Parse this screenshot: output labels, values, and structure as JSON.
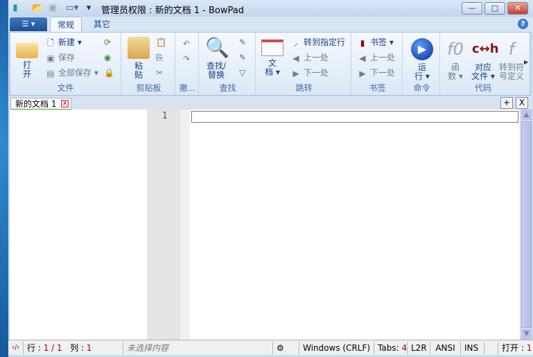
{
  "window": {
    "title": "管理员权限 : 新的文档 1 - BowPad",
    "minimize": "—",
    "maximize": "□",
    "close": "✕"
  },
  "ribbon": {
    "tabs": [
      {
        "label": "常规"
      },
      {
        "label": "其它"
      }
    ],
    "help": "?",
    "groups": {
      "file": {
        "label": "文件",
        "open": "打\n开",
        "new": "新建",
        "save": "保存",
        "save_all": "全部保存"
      },
      "clipboard": {
        "label": "剪贴板",
        "paste": "粘\n贴"
      },
      "undo": {
        "label": "撤..."
      },
      "find": {
        "label": "查找",
        "find_replace": "查找/\n替换"
      },
      "jump": {
        "label": "跳转",
        "doc": "文\n档",
        "goto_line": "转到指定行",
        "prev": "上一处",
        "next": "下一处"
      },
      "bookmark": {
        "label": "书签",
        "bookmarks": "书签",
        "prev": "上一处",
        "next": "下一处"
      },
      "command": {
        "label": "命令",
        "run": "运\n行"
      },
      "code": {
        "label": "代码",
        "functions": "函\n数",
        "corresponding": "对应\n文件",
        "goto_symbol": "转到符\n号定义"
      }
    }
  },
  "document_tabs": [
    {
      "label": "新的文档 1",
      "close": "x"
    }
  ],
  "tab_buttons": {
    "add": "+",
    "close": "X"
  },
  "editor": {
    "line_number": "1",
    "find_value": ""
  },
  "status": {
    "line_label": "行 : ",
    "line_value": "1 / 1",
    "col_label": "列 : ",
    "col_value": "1",
    "selection": "未选择内容",
    "eol": "Windows (CRLF)",
    "tabs_label": "Tabs: ",
    "tabs_value": "4",
    "direction": "L2R",
    "encoding": "ANSI",
    "mode": "INS",
    "open_label": "打开 : ",
    "open_value": "1"
  }
}
